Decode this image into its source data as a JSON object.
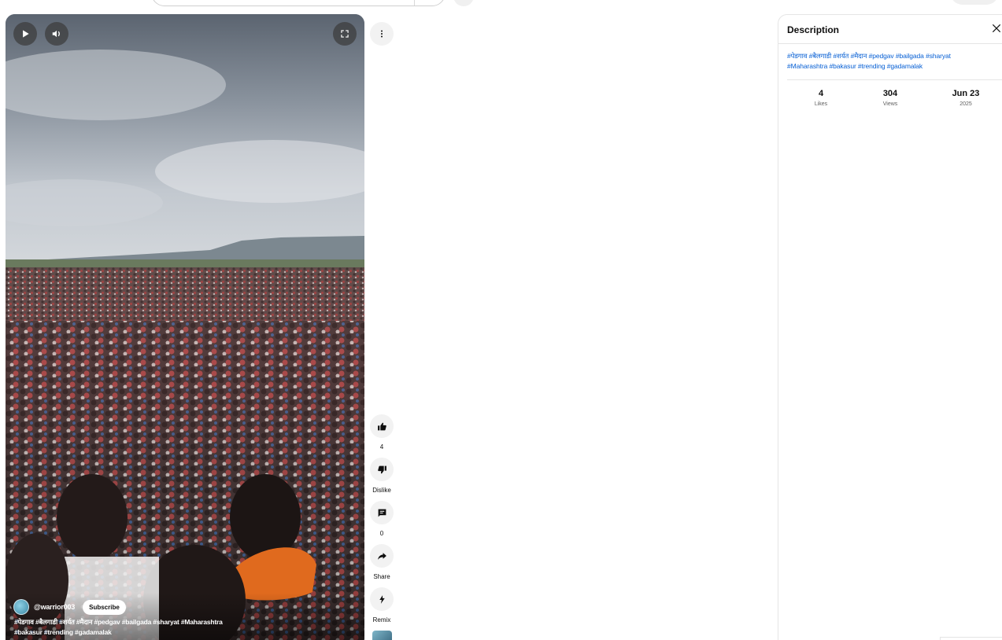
{
  "player": {
    "channel_handle": "@warrior003",
    "subscribe_label": "Subscribe",
    "caption_line1": "#पेडगाव #बैलगाडी #शर्यत #मैदान #pedgav #bailgada #sharyat #Maharashtra",
    "caption_line2": "#bakasur #trending #gadamalak"
  },
  "actions": {
    "like_count": "4",
    "dislike_label": "Dislike",
    "comment_count": "0",
    "share_label": "Share",
    "remix_label": "Remix"
  },
  "description_panel": {
    "title": "Description",
    "tags_line1": "#पेडगाव #बैलगाडी #शर्यत #मैदान #pedgav #bailgada #sharyat",
    "tags_line2": "#Maharashtra #bakasur #trending #gadamalak",
    "stats": [
      {
        "value": "4",
        "unit": "Likes"
      },
      {
        "value": "304",
        "unit": "Views"
      },
      {
        "value": "Jun 23",
        "unit": "2025"
      }
    ]
  },
  "icons": {
    "play": "play-icon",
    "volume": "volume-icon",
    "fullscreen": "fullscreen-icon",
    "more": "more-vert-icon",
    "like": "thumb-up-icon",
    "dislike": "thumb-down-icon",
    "comment": "comment-icon",
    "share": "share-icon",
    "remix": "remix-icon",
    "close": "close-icon"
  },
  "colors": {
    "link": "#065fd4",
    "text": "#0f0f0f",
    "secondary_text": "#606060",
    "button_bg": "#f2f2f2"
  }
}
